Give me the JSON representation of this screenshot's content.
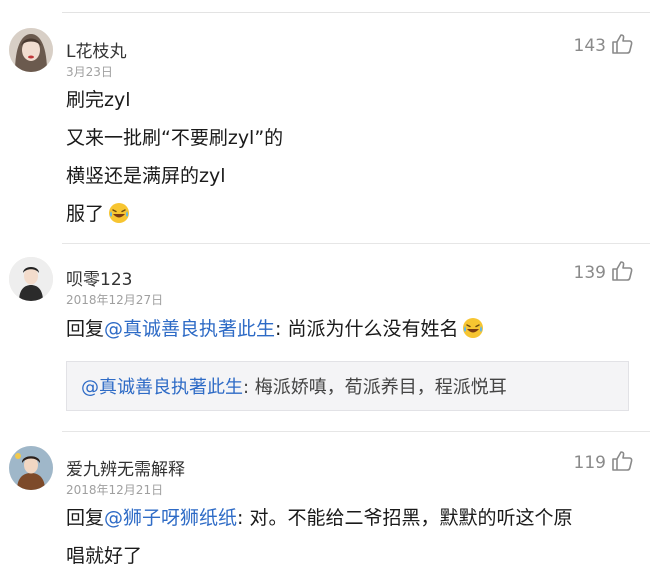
{
  "comments": [
    {
      "username": "L花枝丸",
      "date": "3月23日",
      "likes": "143",
      "lines": [
        "刷完zyl",
        "又来一批刷“不要刷zyl”的",
        "横竖还是满屏的zyl",
        "服了"
      ]
    },
    {
      "username": "呗零123",
      "date": "2018年12月27日",
      "likes": "139",
      "reply_prefix": "回复",
      "mention": "@真诚善良执著此生",
      "text": ": 尚派为什么没有姓名",
      "quote": {
        "mention": "@真诚善良执著此生",
        "text": ": 梅派娇嗔，荀派养目，程派悦耳"
      }
    },
    {
      "username": "爱九辨无需解释",
      "date": "2018年12月21日",
      "likes": "119",
      "reply_prefix": "回复",
      "mention": "@狮子呀狮纸纸",
      "text": ": 对。不能给二爷招黑，默默的听这个原",
      "text_line2": "唱就好了"
    }
  ],
  "icons": {
    "like": "thumbs-up-icon",
    "emoji": "laughing-tears-emoji"
  },
  "colors": {
    "mention": "#2e6bc6",
    "meta": "#a0a0a0",
    "quote_bg": "#f4f4f6"
  }
}
